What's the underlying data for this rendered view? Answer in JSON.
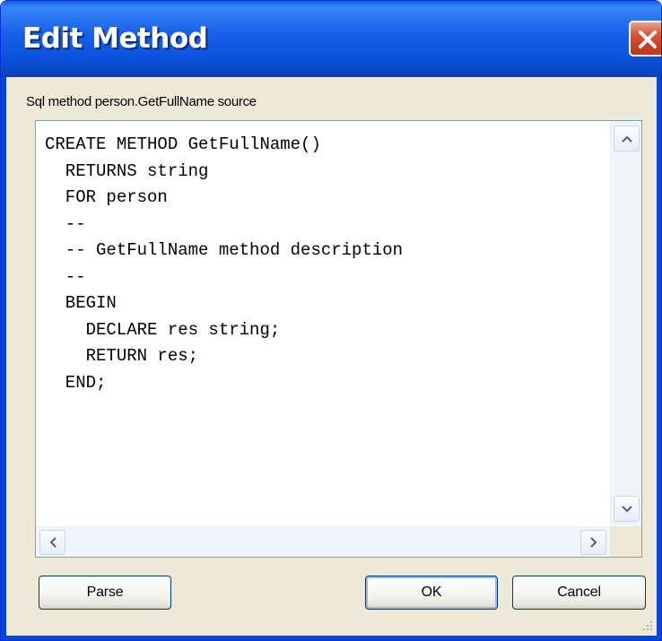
{
  "window": {
    "title": "Edit Method"
  },
  "label": "Sql method person.GetFullName source",
  "code_lines": [
    "CREATE METHOD GetFullName()",
    "  RETURNS string",
    "  FOR person",
    "  --",
    "  -- GetFullName method description",
    "  --",
    "  BEGIN",
    "    DECLARE res string;",
    "    RETURN res;",
    "  END;"
  ],
  "buttons": {
    "parse": "Parse",
    "ok": "OK",
    "cancel": "Cancel"
  },
  "icons": {
    "close": "close-icon",
    "scroll_up": "chevron-up-icon",
    "scroll_down": "chevron-down-icon",
    "scroll_left": "chevron-left-icon",
    "scroll_right": "chevron-right-icon",
    "resize_grip": "resize-grip-icon"
  },
  "colors": {
    "titlebar": "#0a5ee3",
    "frame": "#0a46d1",
    "dialog_bg": "#ece9d8",
    "close_button": "#dd5a3c"
  }
}
